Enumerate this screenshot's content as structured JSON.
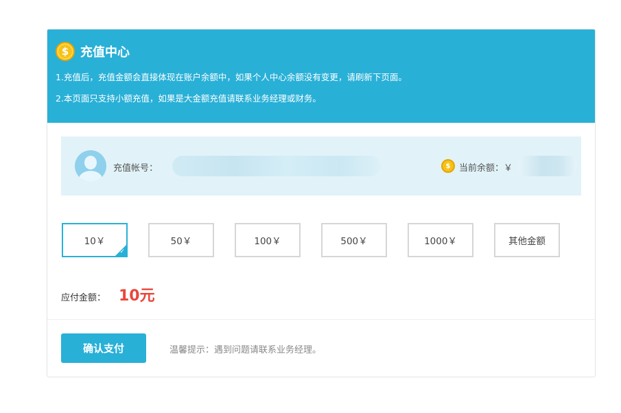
{
  "header": {
    "title": "充值中心",
    "notes": [
      "1.充值后，充值金额会直接体现在账户余额中，如果个人中心余额没有变更，请刷新下页面。",
      "2.本页面只支持小额充值，如果是大金额充值请联系业务经理或财务。"
    ]
  },
  "account": {
    "account_label": "充值帐号：",
    "balance_label": "当前余额：￥"
  },
  "amounts": {
    "options": [
      "10￥",
      "50￥",
      "100￥",
      "500￥",
      "1000￥",
      "其他金额"
    ],
    "selected_index": 0
  },
  "payment": {
    "label": "应付金额：",
    "value": "10元"
  },
  "footer": {
    "confirm_label": "确认支付",
    "tip": "温馨提示：遇到问题请联系业务经理。"
  },
  "icons": {
    "coin": "$",
    "check": "✓"
  },
  "colors": {
    "accent": "#29b0d7",
    "price": "#e9463b",
    "coin": "#f6c21a"
  }
}
